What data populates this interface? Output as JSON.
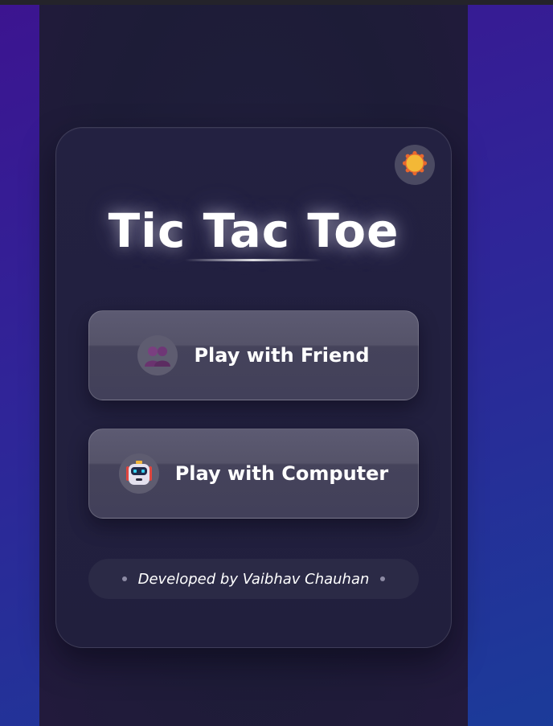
{
  "app": {
    "title": "Tic Tac Toe"
  },
  "theme_toggle": {
    "icon": "sun-icon"
  },
  "menu": {
    "friend_label": "Play with Friend",
    "friend_icon": "two-people-icon",
    "computer_label": "Play with Computer",
    "computer_icon": "robot-icon"
  },
  "footer": {
    "credit": "Developed by Vaibhav Chauhan"
  },
  "colors": {
    "background_start": "#3c1490",
    "background_end": "#1b3b99",
    "card": "#211f3d",
    "button": "#45435b",
    "sun": "#f3b836"
  }
}
